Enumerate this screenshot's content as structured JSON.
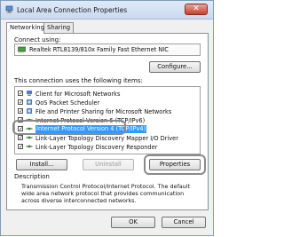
{
  "window": {
    "title": "Local Area Connection Properties",
    "close_glyph": "✕"
  },
  "tabs": [
    {
      "label": "Networking"
    },
    {
      "label": "Sharing"
    }
  ],
  "connect_using": {
    "label": "Connect using:",
    "adapter": "Realtek RTL8139/810x Family Fast Ethernet NIC"
  },
  "configure_button": "Configure...",
  "items_label": "This connection uses the following items:",
  "items": [
    {
      "label": "Client for Microsoft Networks",
      "checked": true,
      "icon": "network-client-icon"
    },
    {
      "label": "QoS Packet Scheduler",
      "checked": true,
      "icon": "network-service-icon"
    },
    {
      "label": "File and Printer Sharing for Microsoft Networks",
      "checked": true,
      "icon": "network-service-icon"
    },
    {
      "label": "Internet Protocol Version 6 (TCP/IPv6)",
      "checked": true,
      "icon": "network-protocol-icon"
    },
    {
      "label": "Internet Protocol Version 4 (TCP/IPv4)",
      "checked": true,
      "icon": "network-protocol-icon",
      "selected": true
    },
    {
      "label": "Link-Layer Topology Discovery Mapper I/O Driver",
      "checked": true,
      "icon": "network-protocol-icon"
    },
    {
      "label": "Link-Layer Topology Discovery Responder",
      "checked": true,
      "icon": "network-protocol-icon"
    }
  ],
  "buttons": {
    "install": "Install...",
    "uninstall": "Uninstall",
    "properties": "Properties",
    "ok": "OK",
    "cancel": "Cancel"
  },
  "description": {
    "label": "Description",
    "text": "Transmission Control Protocol/Internet Protocol. The default wide area network protocol that provides communication across diverse interconnected networks."
  },
  "colors": {
    "selection": "#3399ff",
    "close": "#c6412c"
  }
}
